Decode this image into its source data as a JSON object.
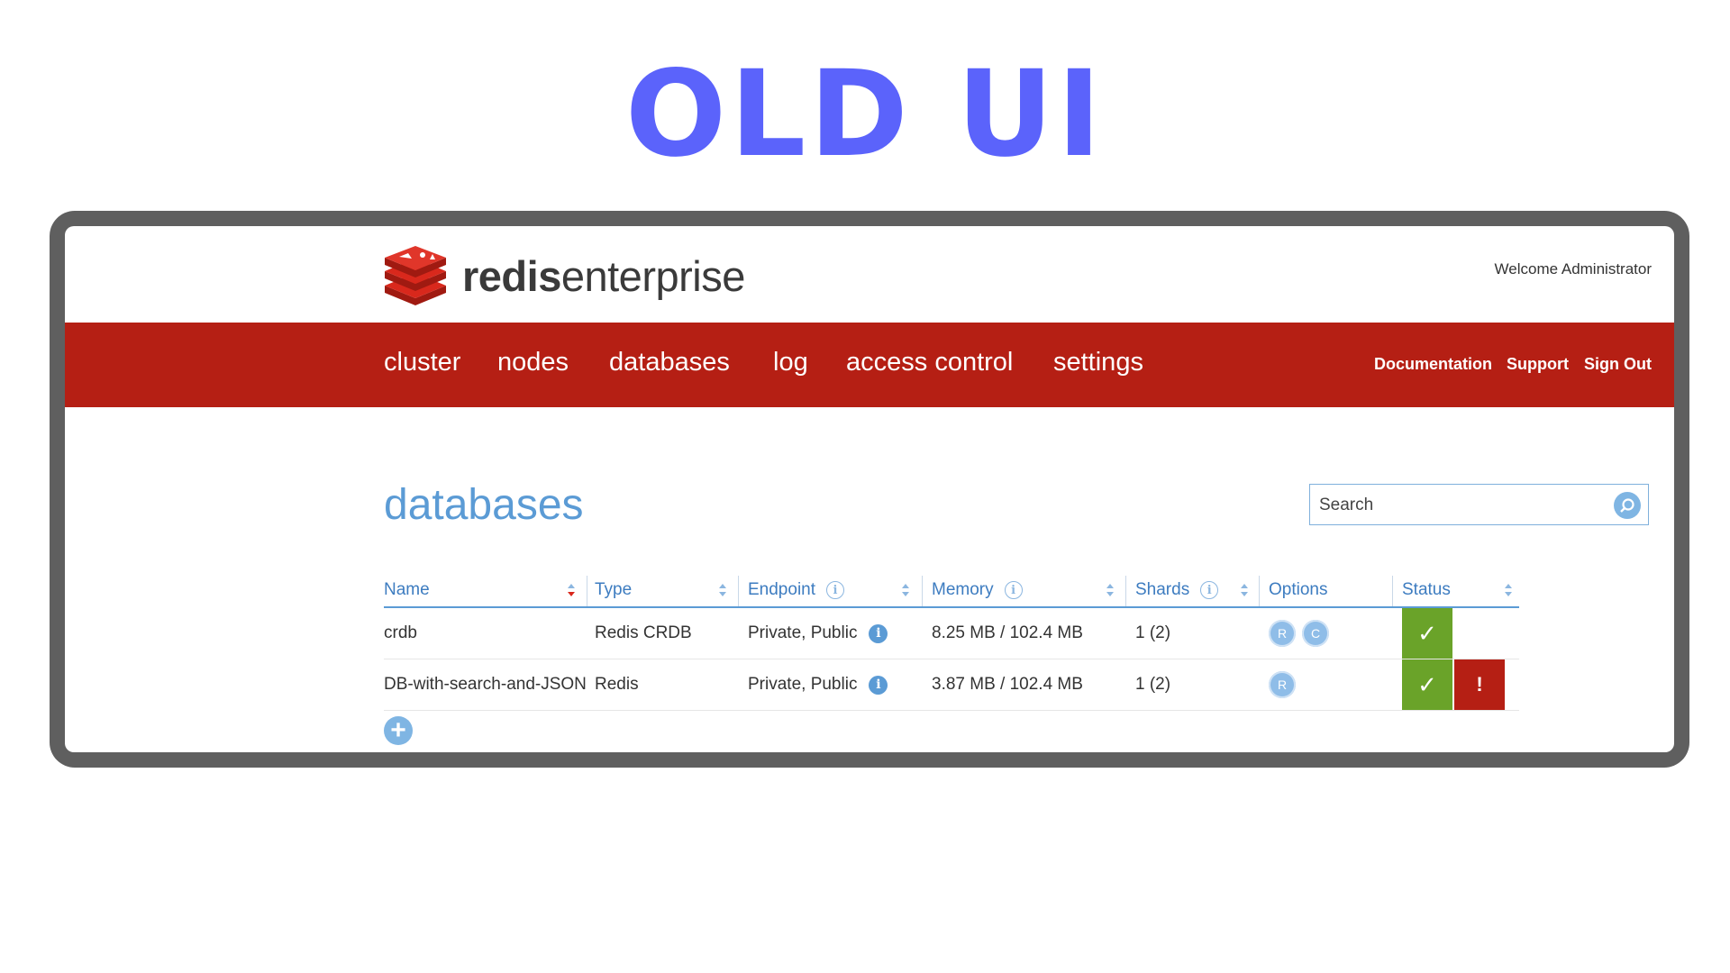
{
  "headline": "OLD UI",
  "app": {
    "logo_bold": "redis",
    "logo_light": "enterprise",
    "welcome": "Welcome Administrator"
  },
  "nav": {
    "items": [
      "cluster",
      "nodes",
      "databases",
      "log",
      "access control",
      "settings"
    ],
    "right": [
      "Documentation",
      "Support",
      "Sign Out"
    ]
  },
  "page": {
    "title": "databases",
    "search_placeholder": "Search"
  },
  "table": {
    "columns": [
      "Name",
      "Type",
      "Endpoint",
      "Memory",
      "Shards",
      "Options",
      "Status"
    ],
    "rows": [
      {
        "name": "crdb",
        "type": "Redis CRDB",
        "endpoint": "Private, Public",
        "memory": "8.25 MB / 102.4 MB",
        "shards": "1 (2)",
        "options": [
          "R",
          "C"
        ],
        "status": [
          "ok"
        ]
      },
      {
        "name": "DB-with-search-and-JSON",
        "type": "Redis",
        "endpoint": "Private, Public",
        "memory": "3.87 MB / 102.4 MB",
        "shards": "1 (2)",
        "options": [
          "R"
        ],
        "status": [
          "ok",
          "error"
        ]
      }
    ]
  },
  "icons": {
    "info": "i",
    "status_ok": "✓",
    "status_error": "!",
    "add": "+"
  },
  "colors": {
    "headline": "#5b63fb",
    "brand_red": "#b51f14",
    "accent_blue": "#5b9bd5",
    "status_green": "#6aa329"
  }
}
